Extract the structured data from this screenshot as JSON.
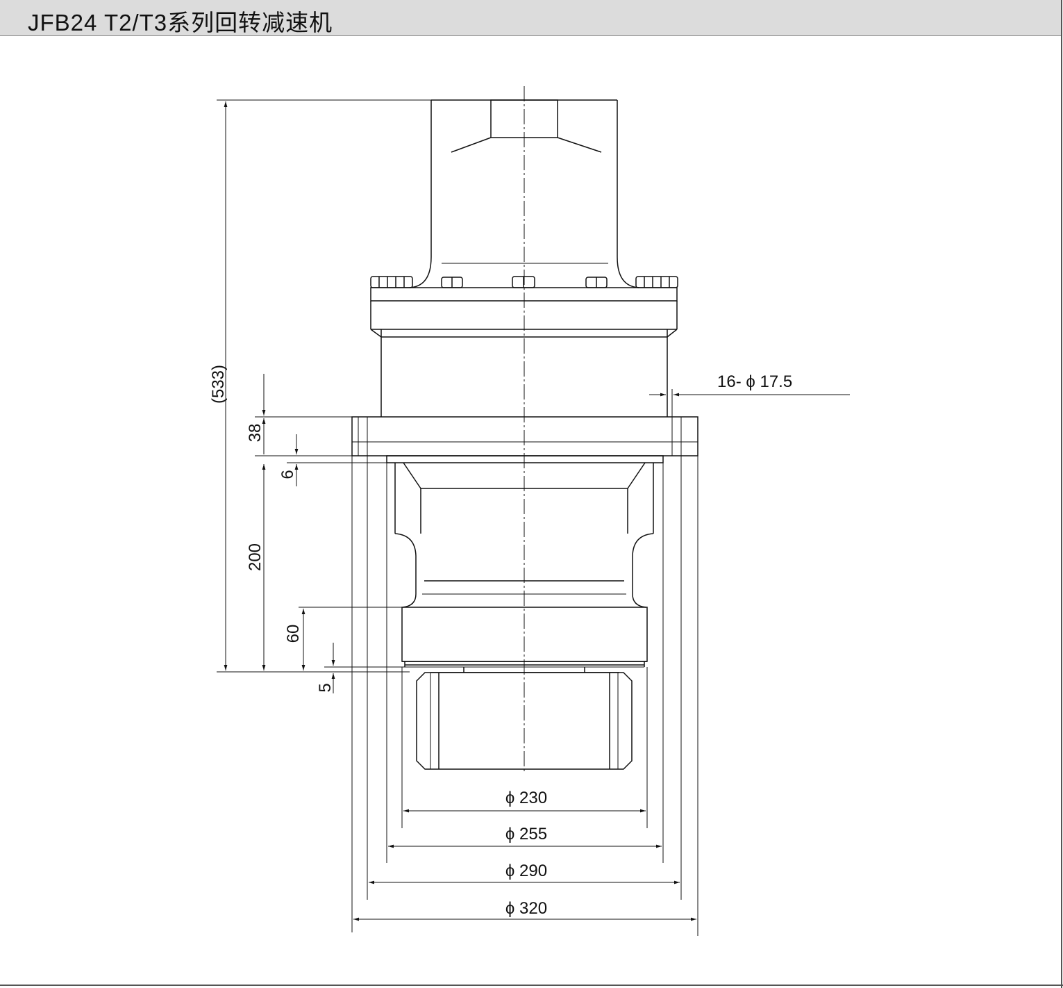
{
  "header": {
    "title": "JFB24 T2/T3系列回转减速机"
  },
  "dimensions": {
    "overall_height": "(533)",
    "flange_thickness": "38",
    "spigot_height": "6",
    "pinion_to_flange": "200",
    "hub_height": "60",
    "gap": "5",
    "bolt_holes": "16- ϕ 17.5",
    "dia_230": "ϕ 230",
    "dia_255": "ϕ 255",
    "dia_290": "ϕ 290",
    "dia_320": "ϕ 320"
  },
  "colors": {
    "line": "#111111",
    "header_bg": "#dcdcdc"
  }
}
